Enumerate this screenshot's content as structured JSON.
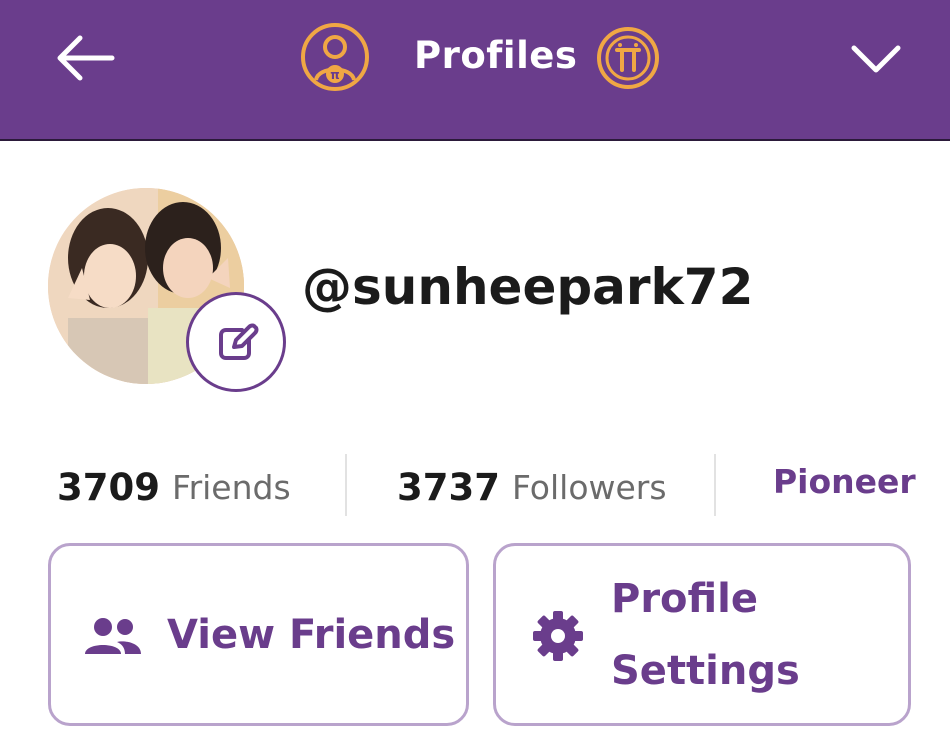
{
  "header": {
    "title": "Profiles",
    "back_icon": "arrow-left-icon",
    "menu_icon": "chevron-down-icon",
    "profile_icon": "profile-pi-icon",
    "coin_icon": "pi-coin-icon"
  },
  "profile": {
    "username": "@sunheepark72",
    "avatar": "avatar-photo",
    "edit_icon": "edit-icon"
  },
  "stats": {
    "friends_count": "3709",
    "friends_label": "Friends",
    "followers_count": "3737",
    "followers_label": "Followers",
    "role": "Pioneer"
  },
  "actions": {
    "view_friends_label": "View Friends",
    "profile_settings_line1": "Profile",
    "profile_settings_line2": "Settings"
  },
  "colors": {
    "brand_purple": "#6a3d8c",
    "accent_orange": "#f0a744",
    "border_lilac": "#b9a3cc"
  }
}
